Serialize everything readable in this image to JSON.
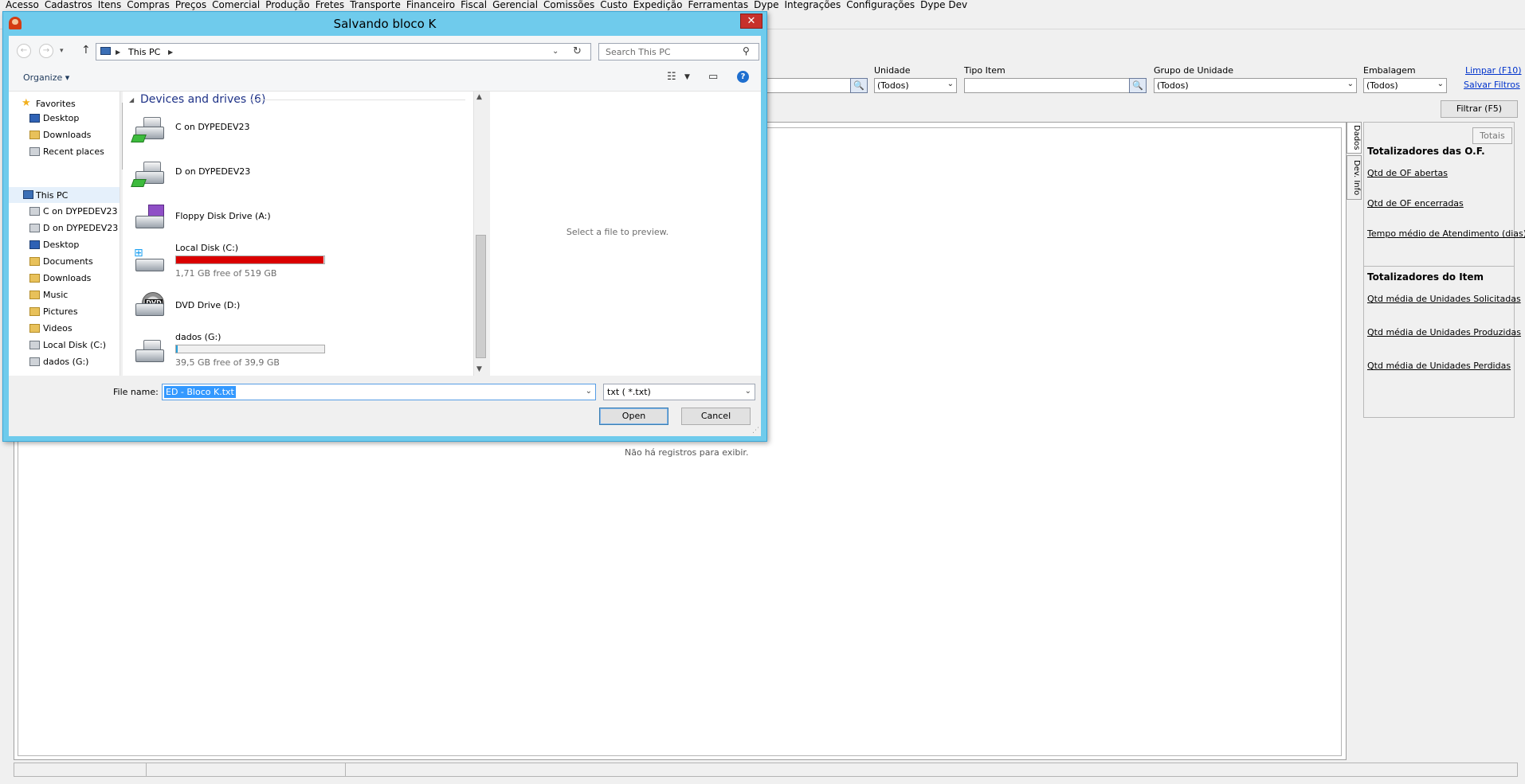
{
  "menu": [
    "Acesso",
    "Cadastros",
    "Itens",
    "Compras",
    "Preços",
    "Comercial",
    "Produção",
    "Fretes",
    "Transporte",
    "Financeiro",
    "Fiscal",
    "Gerencial",
    "Comissões",
    "Custo",
    "Expedição",
    "Ferramentas",
    "Dype",
    "Integrações",
    "Configurações",
    "Dype Dev"
  ],
  "filters": {
    "unidade_label": "Unidade",
    "unidade_value": "(Todos)",
    "tipo_item_label": "Tipo Item",
    "tipo_item_value": "",
    "grupo_unidade_label": "Grupo de Unidade",
    "grupo_unidade_value": "(Todos)",
    "embalagem_label": "Embalagem",
    "embalagem_value": "(Todos)",
    "limpar_link": "Limpar (F10)",
    "salvar_link": "Salvar Filtros",
    "filtrar_button": "Filtrar (F5)"
  },
  "grid": {
    "empty_message": "Não há registros para exibir."
  },
  "vtabs": {
    "dados": "Dados",
    "dev_info": "Dev. Info"
  },
  "side": {
    "totais_button": "Totais",
    "of_title": "Totalizadores das O.F.",
    "of_links": [
      "Qtd de OF abertas",
      "Qtd de OF encerradas",
      "Tempo médio de Atendimento (dias)"
    ],
    "item_title": "Totalizadores do Item",
    "item_links": [
      "Qtd média de Unidades Solicitadas",
      "Qtd média de Unidades Produzidas",
      "Qtd média de Unidades Perdidas"
    ]
  },
  "dialog": {
    "title": "Salvando bloco K",
    "close_label": "✕",
    "address": "This PC",
    "search_placeholder": "Search This PC",
    "organize_label": "Organize",
    "nav": {
      "favorites": "Favorites",
      "favorites_items": [
        "Desktop",
        "Downloads",
        "Recent places"
      ],
      "this_pc": "This PC",
      "this_pc_items": [
        "C on DYPEDEV23",
        "D on DYPEDEV23",
        "Desktop",
        "Documents",
        "Downloads",
        "Music",
        "Pictures",
        "Videos",
        "Local Disk (C:)",
        "dados (G:)"
      ]
    },
    "group_header": "Devices and drives (6)",
    "drives": [
      {
        "name": "C on DYPEDEV23",
        "icon": "network-drive-icon"
      },
      {
        "name": "D on DYPEDEV23",
        "icon": "network-drive-icon"
      },
      {
        "name": "Floppy Disk Drive (A:)",
        "icon": "floppy-drive-icon"
      },
      {
        "name": "Local Disk (C:)",
        "icon": "windows-disk-icon",
        "free": "1,71 GB free of 519 GB",
        "used_fraction": 0.997,
        "bar_color": "#da0000"
      },
      {
        "name": "DVD Drive (D:)",
        "icon": "dvd-drive-icon"
      },
      {
        "name": "dados (G:)",
        "icon": "disk-drive-icon",
        "free": "39,5 GB free of 39,9 GB",
        "used_fraction": 0.01,
        "bar_color": "#26a0da"
      }
    ],
    "preview_text": "Select a file to preview.",
    "file_name_label": "File name:",
    "file_name_value": "ED - Bloco K.txt",
    "file_type_value": "txt ( *.txt)",
    "open_button": "Open",
    "cancel_button": "Cancel"
  },
  "colors": {
    "dialog_frame": "#6fcbec",
    "close": "#c7312b",
    "accent_link": "#0033cc"
  }
}
